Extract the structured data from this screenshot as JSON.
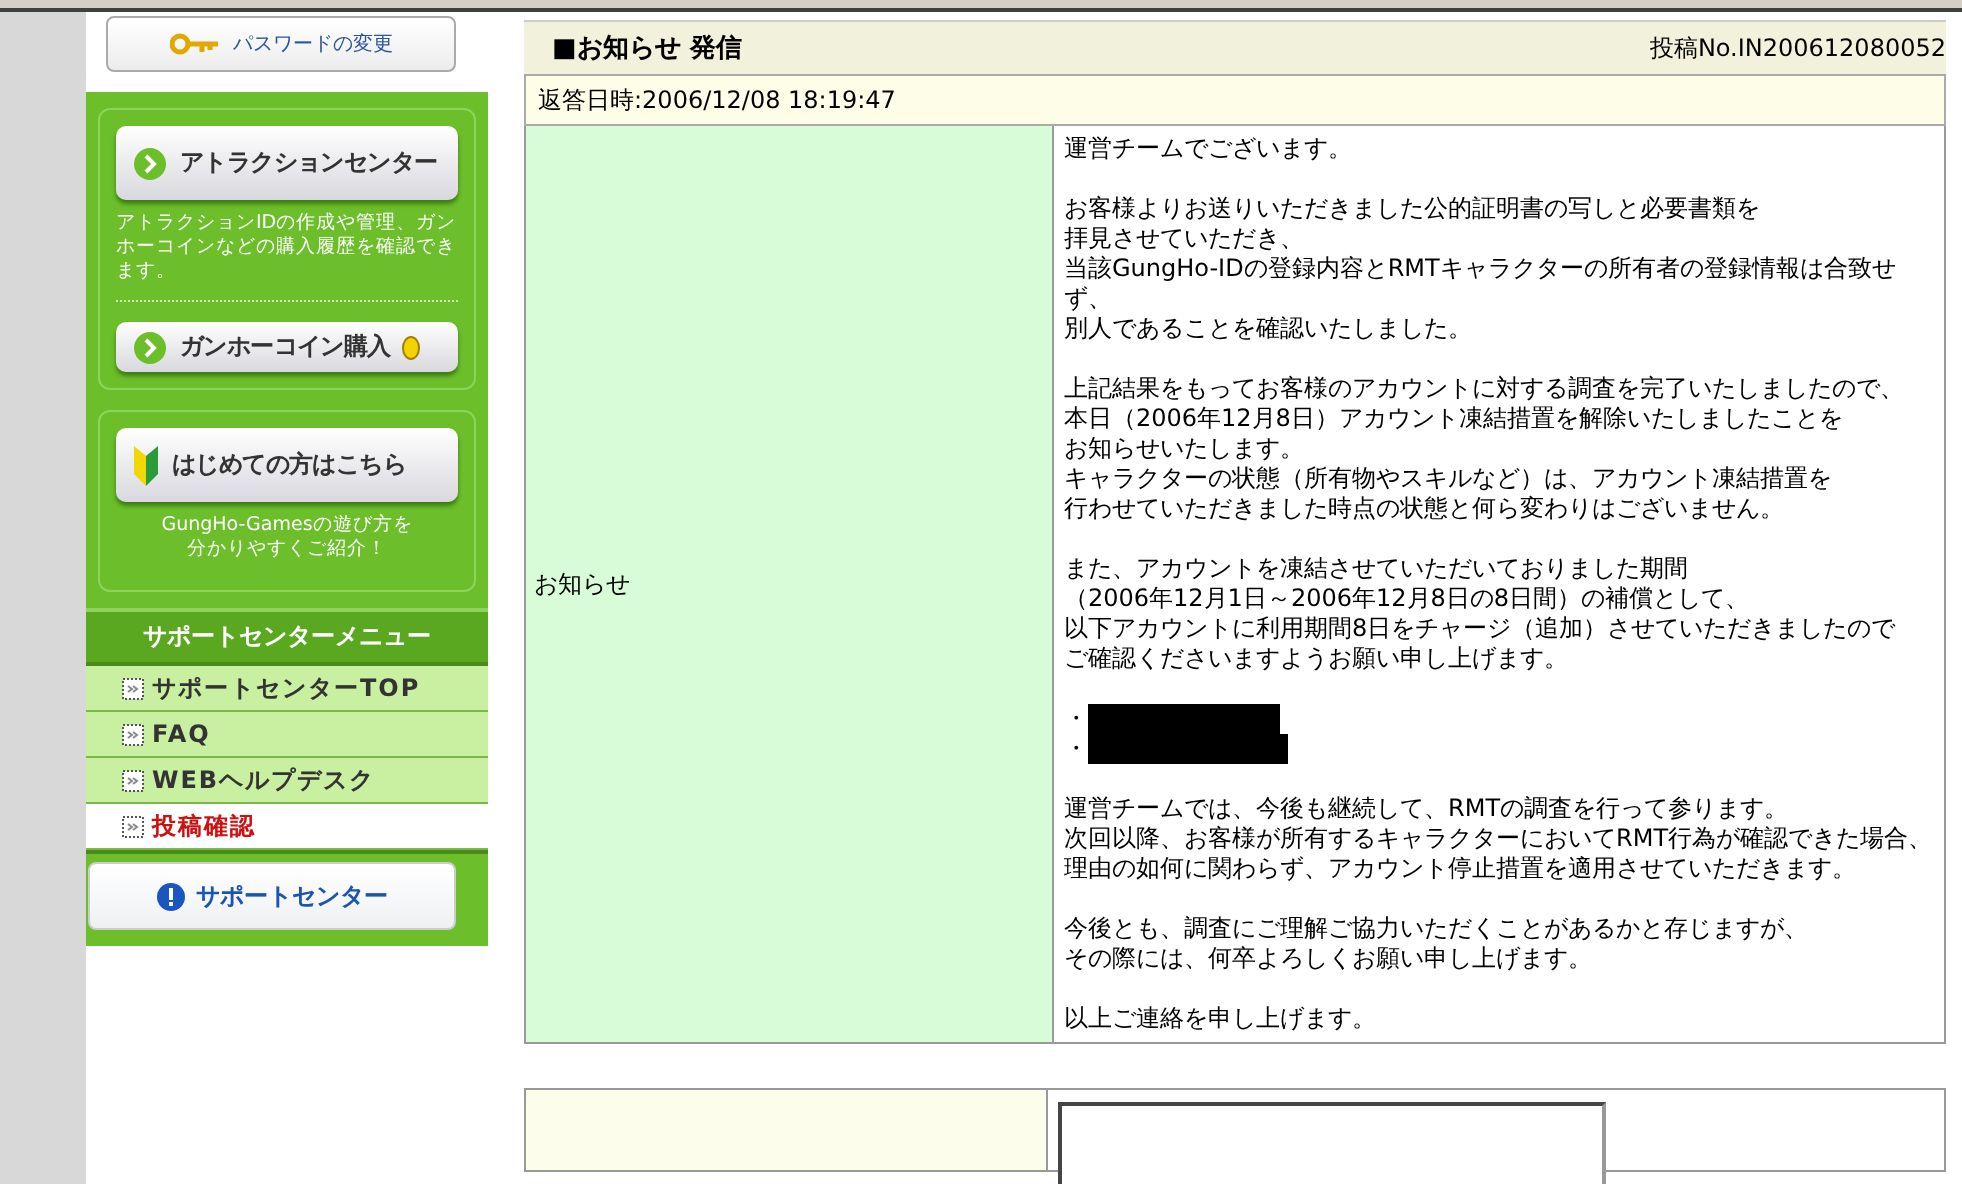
{
  "sidebar": {
    "password_link": "パスワードの変更",
    "attraction": {
      "button": "アトラクションセンター",
      "description": "アトラクションIDの作成や管理、ガンホーコインなどの購入履歴を確認できます。",
      "coin_button": "ガンホーコイン購入"
    },
    "beginner": {
      "button": "はじめての方はこちら",
      "description": [
        "GungHo-Gamesの遊び方を",
        "分かりやすくご紹介！"
      ]
    },
    "menu": {
      "title": "サポートセンターメニュー",
      "items": [
        {
          "label": "サポートセンターTOP",
          "selected": false
        },
        {
          "label": "FAQ",
          "selected": false
        },
        {
          "label": "WEBヘルプデスク",
          "selected": false
        },
        {
          "label": "投稿確認",
          "selected": true
        }
      ]
    },
    "support_button": "サポートセンター"
  },
  "notice": {
    "title": "■お知らせ 発信",
    "post_no": "投稿No.IN200612080052",
    "reply_datetime": "返答日時:2006/12/08 18:19:47",
    "label": "お知らせ",
    "paragraphs": [
      {
        "kind": "text",
        "lines": [
          "運営チームでございます。"
        ]
      },
      {
        "kind": "text",
        "lines": [
          "お客様よりお送りいただきました公的証明書の写しと必要書類を",
          "拝見させていただき、",
          "当該GungHo-IDの登録内容とRMTキャラクターの所有者の登録情報は合致せ",
          "ず、",
          "別人であることを確認いたしました。"
        ]
      },
      {
        "kind": "text",
        "lines": [
          "上記結果をもってお客様のアカウントに対する調査を完了いたしましたので、",
          "本日（2006年12月8日）アカウント凍結措置を解除いたしましたことを",
          "お知らせいたします。",
          "キャラクターの状態（所有物やスキルなど）は、アカウント凍結措置を",
          "行わせていただきました時点の状態と何ら変わりはございません。"
        ]
      },
      {
        "kind": "text",
        "lines": [
          "また、アカウントを凍結させていただいておりました期間",
          "（2006年12月1日～2006年12月8日の8日間）の補償として、",
          "以下アカウントに利用期間8日をチャージ（追加）させていただきましたので",
          "ご確認くださいますようお願い申し上げます。"
        ]
      },
      {
        "kind": "redacted",
        "lines": [
          "・",
          "・"
        ]
      },
      {
        "kind": "text",
        "lines": [
          "運営チームでは、今後も継続して、RMTの調査を行って参ります。",
          "次回以降、お客様が所有するキャラクターにおいてRMT行為が確認できた場合、",
          "理由の如何に関わらず、アカウント停止措置を適用させていただきます。"
        ]
      },
      {
        "kind": "text",
        "lines": [
          "今後とも、調査にご理解ご協力いただくことがあるかと存じますが、",
          "その際には、何卒よろしくお願い申し上げます。"
        ]
      },
      {
        "kind": "text",
        "lines": [
          "以上ご連絡を申し上げます。"
        ]
      }
    ]
  }
}
